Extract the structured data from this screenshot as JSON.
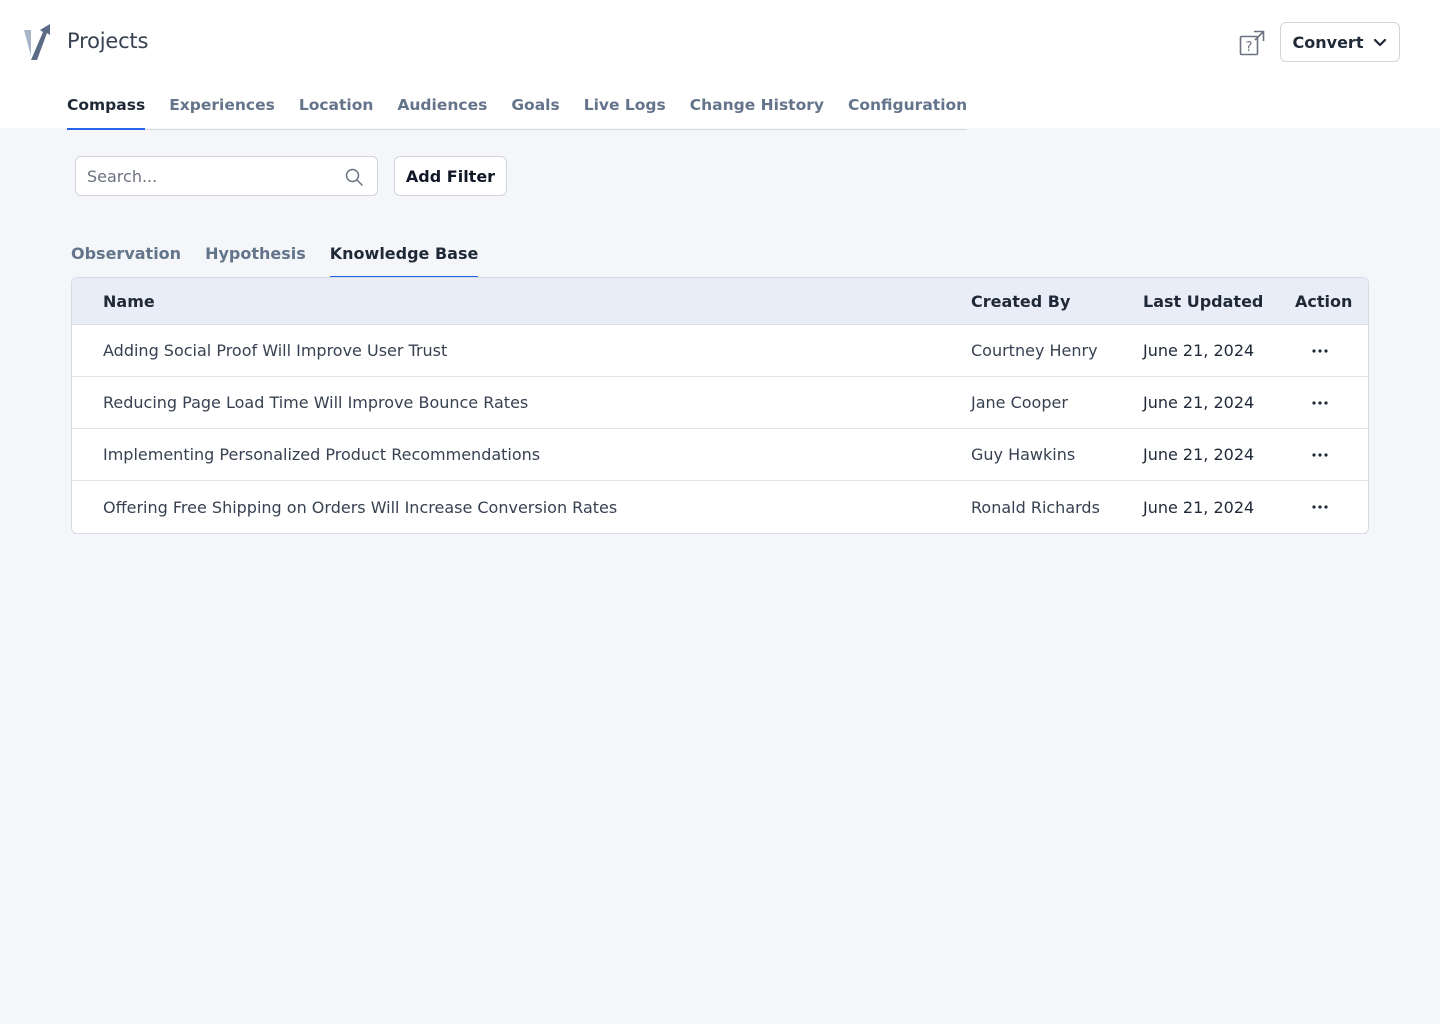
{
  "header": {
    "title": "Projects",
    "logo_icon": "logo-icon",
    "help_icon": "help-external-icon",
    "convert_label": "Convert"
  },
  "nav": {
    "items": [
      {
        "label": "Compass",
        "active": true
      },
      {
        "label": "Experiences",
        "active": false
      },
      {
        "label": "Location",
        "active": false
      },
      {
        "label": "Audiences",
        "active": false
      },
      {
        "label": "Goals",
        "active": false
      },
      {
        "label": "Live Logs",
        "active": false
      },
      {
        "label": "Change History",
        "active": false
      },
      {
        "label": "Configuration",
        "active": false
      }
    ]
  },
  "toolbar": {
    "search_placeholder": "Search...",
    "search_value": "",
    "add_filter_label": "Add Filter"
  },
  "tabs": {
    "items": [
      {
        "label": "Observation",
        "active": false
      },
      {
        "label": "Hypothesis",
        "active": false
      },
      {
        "label": "Knowledge Base",
        "active": true
      }
    ]
  },
  "table": {
    "columns": {
      "name": "Name",
      "created_by": "Created By",
      "last_updated": "Last Updated",
      "action": "Action"
    },
    "rows": [
      {
        "name": "Adding Social Proof Will Improve User Trust",
        "created_by": "Courtney Henry",
        "last_updated": "June 21, 2024"
      },
      {
        "name": "Reducing Page Load Time Will Improve Bounce Rates",
        "created_by": "Jane Cooper",
        "last_updated": "June 21, 2024"
      },
      {
        "name": "Implementing Personalized Product Recommendations",
        "created_by": "Guy Hawkins",
        "last_updated": "June 21, 2024"
      },
      {
        "name": "Offering Free Shipping on Orders Will Increase Conversion Rates",
        "created_by": "Ronald Richards",
        "last_updated": "June 21, 2024"
      }
    ]
  },
  "colors": {
    "accent": "#2563eb",
    "background": "#f4f6fa",
    "table_header": "#e8edf7"
  }
}
